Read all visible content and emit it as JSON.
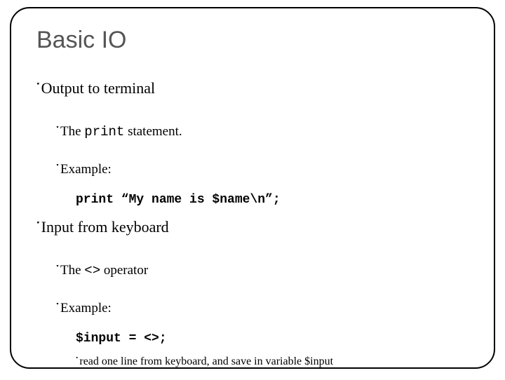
{
  "title": "Basic IO",
  "bullet": "་",
  "items": {
    "output": {
      "heading": "Output to terminal",
      "line1_pre": "The ",
      "line1_code": "print",
      "line1_post": " statement.",
      "example_label": "Example:",
      "code": "print “My name is $name\\n”;"
    },
    "input": {
      "heading": "Input from keyboard",
      "line1_pre": "The ",
      "line1_code": "<>",
      "line1_post": " operator",
      "example_label": "Example:",
      "code": "$input = <>;",
      "note": "read one line from keyboard, and save in variable $input"
    }
  }
}
